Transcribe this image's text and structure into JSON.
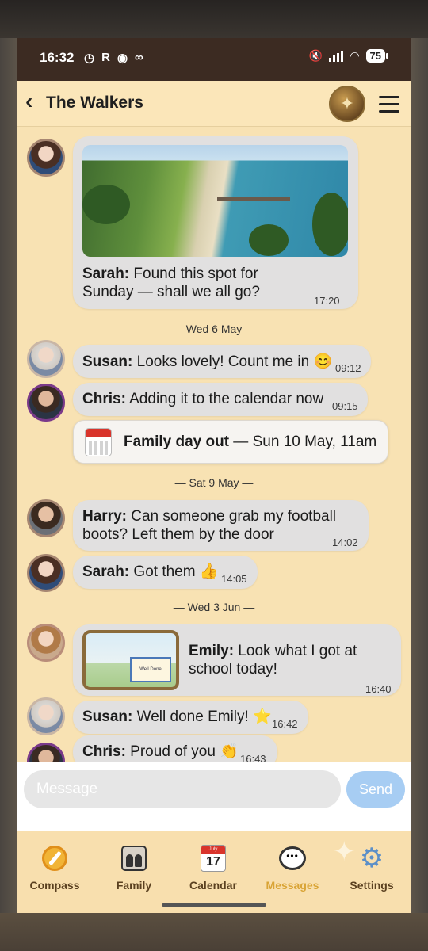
{
  "status_bar": {
    "time": "16:32",
    "left_icons": [
      "timer-icon",
      "R",
      "shazam-icon",
      "voicemail-icon"
    ],
    "battery": "75"
  },
  "header": {
    "title": "The Walkers"
  },
  "messages": [
    {
      "sender": "Sarah:",
      "text": " Found this spot for Sunday — shall we all go?",
      "time": "17:20"
    },
    {
      "sender": "Susan:",
      "text": " Looks lovely! Count me in 😊",
      "time": "09:12"
    },
    {
      "sender": "Chris:",
      "text": " Adding it to the calendar now",
      "time": "09:15"
    },
    {
      "sender": "Harry:",
      "text": " Can someone grab my football boots? Left them by the door",
      "time": "14:02"
    },
    {
      "sender": "Sarah:",
      "text": " Got them 👍",
      "time": "14:05"
    },
    {
      "sender": "Emily:",
      "text": " Look what I got at school today!",
      "time": "16:40"
    },
    {
      "sender": "Susan:",
      "text": " Well done Emily! ⭐",
      "time": "16:42"
    },
    {
      "sender": "Chris:",
      "text": " Proud of you 👏",
      "time": "16:43"
    }
  ],
  "day_separators": [
    "— Wed 6 May —",
    "— Sat 9 May —",
    "— Wed 3 Jun —"
  ],
  "event": {
    "name": "Family day out",
    "details": " — Sun 10 May, 11am"
  },
  "drawing": {
    "certificate_text": "Well Done"
  },
  "composer": {
    "placeholder": "Message",
    "send_label": "Send"
  },
  "tabs": [
    {
      "label": "Compass",
      "icon": "compass-icon"
    },
    {
      "label": "Family",
      "icon": "family-icon"
    },
    {
      "label": "Calendar",
      "icon": "calendar-icon",
      "date": "17",
      "month": "July"
    },
    {
      "label": "Messages",
      "icon": "messages-icon",
      "active": true
    },
    {
      "label": "Settings",
      "icon": "gear-icon"
    }
  ],
  "colors": {
    "chat_background": "#f8e2b3",
    "bubble": "#e1e0e0",
    "send_button": "#a7cdf3",
    "active_tab": "#d9a436",
    "status_bar": "#3c2b22"
  }
}
